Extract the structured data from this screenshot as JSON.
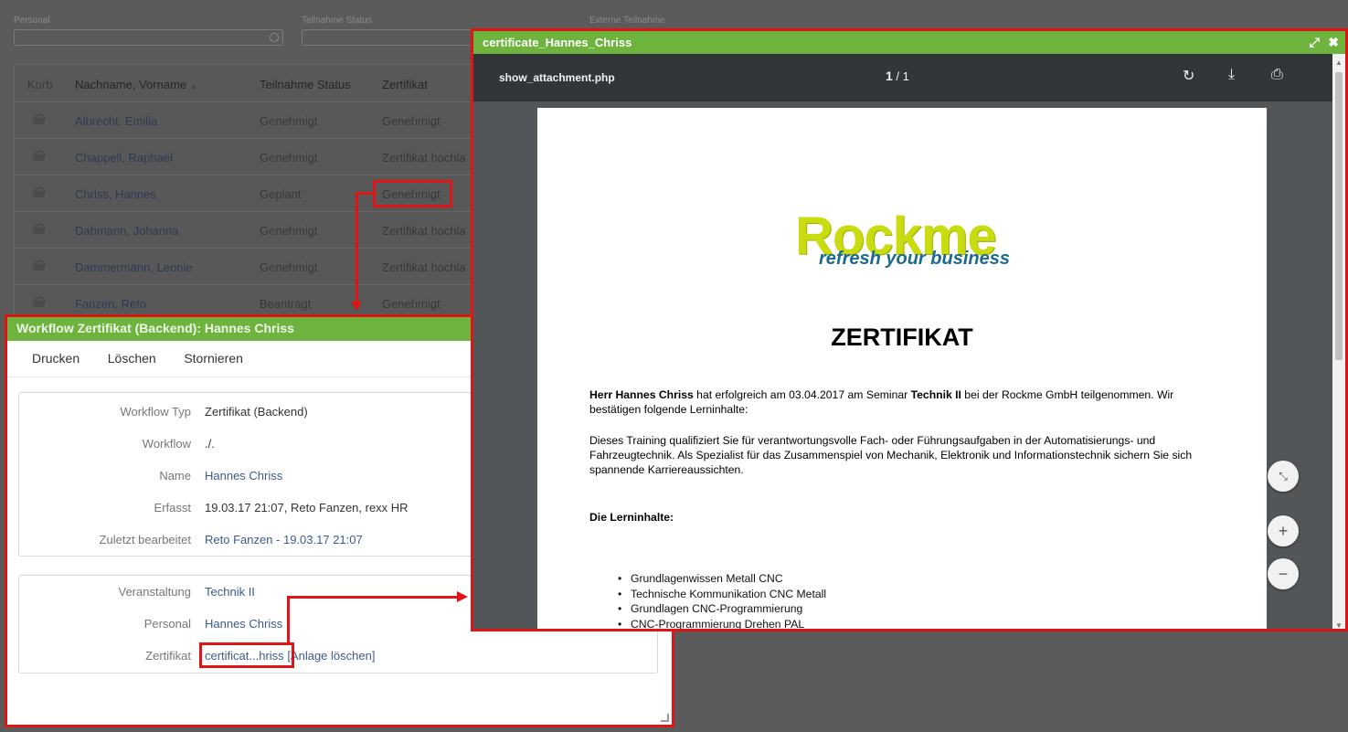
{
  "filters": [
    {
      "label": "Personal"
    },
    {
      "label": "Teilnahme Status"
    },
    {
      "label": "Externe Teilnahme"
    }
  ],
  "list": {
    "headers": {
      "korb": "Korb",
      "name": "Nachname, Vorname",
      "sort_icon": "▲",
      "status": "Teilnahme Status",
      "zertifikat": "Zertifikat"
    },
    "rows": [
      {
        "name": "Albrecht, Emilia",
        "status": "Genehmigt",
        "zertifikat": "Genehmigt"
      },
      {
        "name": "Chappell, Raphael",
        "status": "Genehmigt",
        "zertifikat": "Zertifikat hochla"
      },
      {
        "name": "Chriss, Hannes",
        "status": "Geplant",
        "zertifikat": "Genehmigt"
      },
      {
        "name": "Dahmann, Johanna",
        "status": "Genehmigt",
        "zertifikat": "Zertifikat hochla"
      },
      {
        "name": "Dammermann, Leonie",
        "status": "Genehmigt",
        "zertifikat": "Zertifikat hochla"
      },
      {
        "name": "Fanzen, Reto",
        "status": "Beantragt",
        "zertifikat": "Genehmigt"
      }
    ]
  },
  "workflow": {
    "title": "Workflow Zertifikat (Backend): Hannes Chriss",
    "toolbar": {
      "print": "Drucken",
      "delete": "Löschen",
      "cancel": "Stornieren"
    },
    "section1": [
      {
        "label": "Workflow Typ",
        "value": "Zertifikat (Backend)"
      },
      {
        "label": "Workflow",
        "value": "./."
      },
      {
        "label": "Name",
        "value": "Hannes Chriss"
      },
      {
        "label": "Erfasst",
        "value": "19.03.17 21:07, Reto Fanzen, rexx HR"
      },
      {
        "label": "Zuletzt bearbeitet",
        "value": "Reto Fanzen - 19.03.17 21:07"
      }
    ],
    "section2": [
      {
        "label": "Veranstaltung",
        "value": "Technik II"
      },
      {
        "label": "Personal",
        "value": "Hannes Chriss"
      },
      {
        "label": "Zertifikat",
        "value": "certificat...hriss",
        "extra": "[Anlage löschen]"
      }
    ]
  },
  "pdf": {
    "window_title": "certificate_Hannes_Chriss",
    "filename": "show_attachment.php",
    "page_current": "1",
    "page_sep": " / ",
    "page_total": "1",
    "icons": {
      "expand": "expand-icon",
      "close": "close-icon",
      "rotate": "rotate-icon",
      "download": "download-icon",
      "print": "print-icon",
      "fit": "fit-page-icon",
      "zoom_in": "zoom-in-icon",
      "zoom_out": "zoom-out-icon"
    },
    "document": {
      "logo_main": "Rockme",
      "logo_sub": "refresh your business",
      "title": "ZERTIFIKAT",
      "p1_bold1": "Herr Hannes Chriss",
      "p1_mid": " hat erfolgreich am 03.04.2017 am Seminar  ",
      "p1_bold2": "Technik II",
      "p1_end": " bei der Rockme GmbH teilgenommen. Wir bestätigen folgende Lerninhalte:",
      "p2": "Dieses Training qualifiziert Sie für verantwortungsvolle Fach- oder Führungsaufgaben in der Automatisierungs- und Fahrzeugtechnik. Als Spezialist für das Zusammenspiel von Mechanik, Elektronik und Informationstechnik sichern Sie sich spannende Karriereaussichten.",
      "section_heading": "Die Lerninhalte:",
      "items": [
        "Grundlagenwissen Metall CNC",
        "Technische Kommunikation CNC Metall",
        "Grundlagen CNC-Programmierung",
        "CNC-Programmierung Drehen PAL"
      ]
    }
  },
  "colors": {
    "title_green": "#6fb33f",
    "highlight_red": "#e01414",
    "pdf_toolbar": "#323639"
  }
}
